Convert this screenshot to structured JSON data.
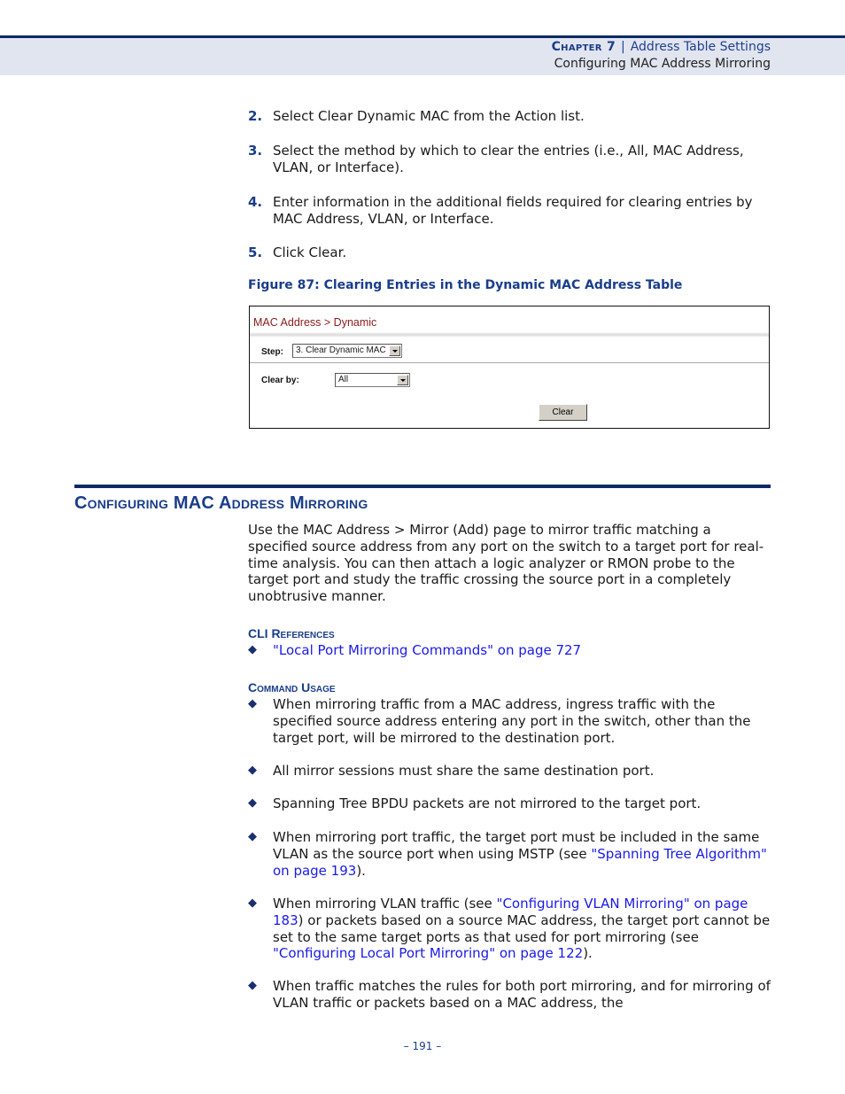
{
  "header": {
    "chapter": "Chapter 7",
    "separator": "|",
    "chapter_title": "Address Table Settings",
    "section": "Configuring MAC Address Mirroring"
  },
  "steps": [
    {
      "num": "2.",
      "text": "Select Clear Dynamic MAC from the Action list."
    },
    {
      "num": "3.",
      "text": "Select the method by which to clear the entries (i.e., All, MAC Address, VLAN, or Interface)."
    },
    {
      "num": "4.",
      "text": "Enter information in the additional fields required for clearing entries by MAC Address, VLAN, or Interface."
    },
    {
      "num": "5.",
      "text": "Click Clear."
    }
  ],
  "figure": {
    "caption": "Figure 87:  Clearing Entries in the Dynamic MAC Address Table",
    "title": "MAC Address > Dynamic",
    "step_label": "Step:",
    "step_value": "3. Clear Dynamic MAC",
    "clear_by_label": "Clear by:",
    "clear_by_value": "All",
    "clear_button": "Clear"
  },
  "section": {
    "title": "Configuring MAC Address Mirroring",
    "intro": "Use the MAC Address > Mirror (Add) page to mirror traffic matching a specified source address from any port on the switch to a target port for real-time analysis. You can then attach a logic analyzer or RMON probe to the target port and study the traffic crossing the source port in a completely unobtrusive manner.",
    "cli_heading": "CLI References",
    "cli_link": "\"Local Port Mirroring Commands\" on page 727",
    "usage_heading": "Command Usage",
    "bullets": [
      {
        "text": "When mirroring traffic from a MAC address, ingress traffic with the specified source address entering any port in the switch, other than the target port, will be mirrored to the destination port."
      },
      {
        "text": "All mirror sessions must share the same destination port."
      },
      {
        "text": "Spanning Tree BPDU packets are not mirrored to the target port."
      },
      {
        "pre": "When mirroring port traffic, the target port must be included in the same VLAN as the source port when using MSTP (see ",
        "link": "\"Spanning Tree Algorithm\" on page 193",
        "post": ")."
      },
      {
        "pre": "When mirroring VLAN traffic (see ",
        "link": "\"Configuring VLAN Mirroring\" on page 183",
        "mid": ") or packets based on a source MAC address, the target port cannot be set to the same target ports as that used for port mirroring (see ",
        "link2": "\"Configuring Local Port Mirroring\" on page 122",
        "post": ")."
      },
      {
        "text": "When traffic matches the rules for both port mirroring, and for mirroring of VLAN traffic or packets based on a MAC address, the"
      }
    ]
  },
  "footer": {
    "page": "–  191  –"
  }
}
